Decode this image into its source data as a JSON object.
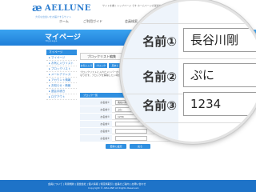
{
  "header": {
    "logo_mark": "æ",
    "logo_text": "AELLUNE",
    "logo_sub": "大切な出会いをお届けするサイト",
    "tagline": "サイトを書くトップページ です ホームページの運営を心がけてお客様とサービスを提供します"
  },
  "nav": {
    "items": [
      {
        "label": "ホーム"
      },
      {
        "label": "ご利用ガイド"
      },
      {
        "label": "会員検索"
      },
      {
        "label": "メッセージ"
      },
      {
        "label": "コミュ"
      }
    ]
  },
  "banner": {
    "title": "マイページ",
    "subtitle": "Mypage"
  },
  "sidebar": {
    "heading": "マイページ",
    "items": [
      {
        "label": "マイページ"
      },
      {
        "label": "お気に入りリスト"
      },
      {
        "label": "ブロックリスト"
      },
      {
        "label": "メールアドレス"
      },
      {
        "label": "アカウント情報"
      },
      {
        "label": "お知らせ・情報"
      },
      {
        "label": "退会手続き"
      },
      {
        "label": "ログアウト"
      }
    ]
  },
  "main": {
    "panel_title": "ブロックリスト編集",
    "tabs": [
      {
        "label": "お気に入り"
      },
      {
        "label": "ブロック"
      },
      {
        "label": "足あと"
      }
    ],
    "description": "ブロックリストに入れたメンバーからはメッセージや 足あと等のアクションを受けなくなります。ブロックを解除したい場合は、リストから削除してください。",
    "form_heading": "ブロック一覧",
    "rows": [
      {
        "label": "お名前①",
        "value": "長谷川剛"
      },
      {
        "label": "お名前②",
        "value": "ぷに"
      },
      {
        "label": "お名前③",
        "value": "1234"
      },
      {
        "label": "お名前④",
        "value": ""
      },
      {
        "label": "お名前⑤",
        "value": ""
      },
      {
        "label": "お名前⑥",
        "value": ""
      }
    ],
    "buttons": {
      "update": "更新に設定",
      "back": "戻る"
    }
  },
  "magnifier": {
    "rows": [
      {
        "label": "名前①",
        "value": "長谷川剛"
      },
      {
        "label": "名前②",
        "value": "ぷに"
      },
      {
        "label": "名前③",
        "value": "1234"
      }
    ]
  },
  "footer": {
    "links": "会員について | 利用規約 | 運営会社 | 個人情報 | 特定商取引 | 会員のご案内 | お問い合わせ",
    "copyright": "Copyright © AELLUNE All Rights Reserved."
  }
}
